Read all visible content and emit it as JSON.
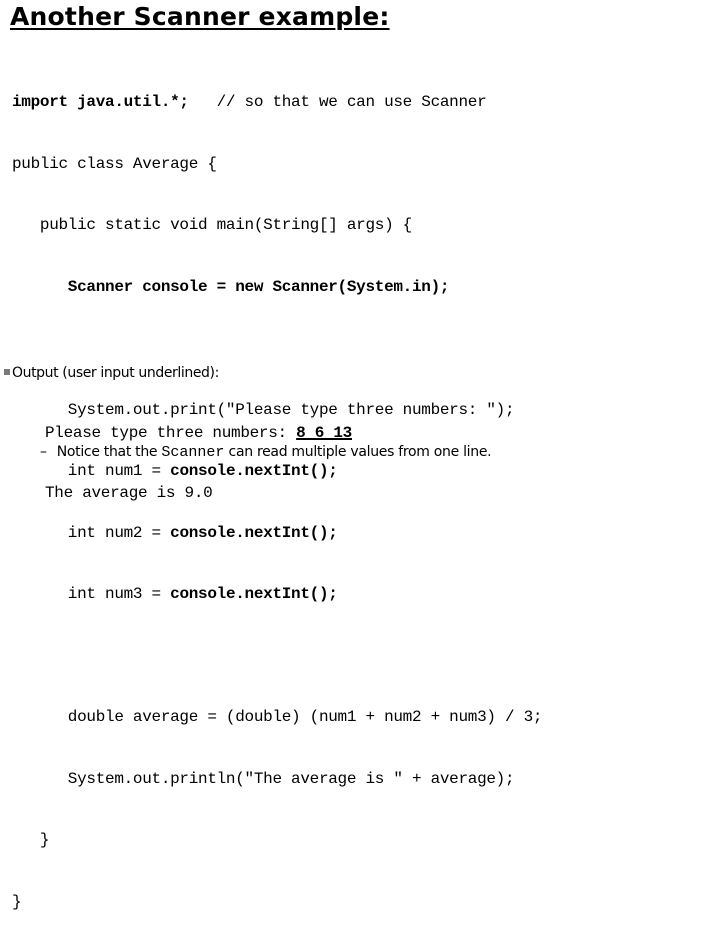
{
  "title": "Another Scanner example:",
  "code": {
    "l1_bold": "import java.util.*;",
    "l1_comment": "   // so that we can use Scanner",
    "l2": "public class Average {",
    "l3": "   public static void main(String[] args) {",
    "l4": "      Scanner console = new Scanner(System.in);",
    "l5": "",
    "l6": "      System.out.print(\"Please type three numbers: \");",
    "l7_pre": "      int num1 = ",
    "l7_bold": "console.nextInt();",
    "l8_pre": "      int num2 = ",
    "l8_bold": "console.nextInt();",
    "l9_pre": "      int num3 = ",
    "l9_bold": "console.nextInt();",
    "l10": "",
    "l11": "      double average = (double) (num1 + num2 + num3) / 3;",
    "l12": "      System.out.println(\"The average is \" + average);",
    "l13": "   }",
    "l14": "}"
  },
  "output": {
    "heading": "Output (user input underlined):",
    "prompt": "Please type three numbers: ",
    "user_input": "8 6 13",
    "result": "The average is 9.0"
  },
  "note": {
    "dash": "–",
    "before": "Notice that the ",
    "mono": "Scanner",
    "after": " can read multiple values from one line."
  }
}
